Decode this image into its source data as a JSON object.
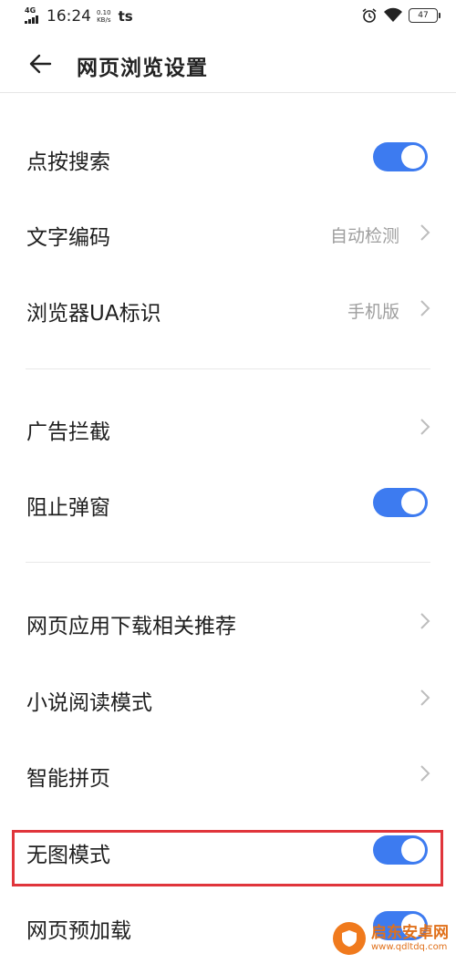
{
  "status": {
    "network": "4G",
    "time": "16:24",
    "speed_value": "0.10",
    "speed_unit": "KB/s",
    "app_glyph": "ts",
    "battery": "47"
  },
  "header": {
    "back_icon": "arrow-left-icon",
    "title": "网页浏览设置"
  },
  "settings": {
    "tap_search": {
      "label": "点按搜索",
      "toggle_on": true
    },
    "text_encoding": {
      "label": "文字编码",
      "value": "自动检测"
    },
    "ua": {
      "label": "浏览器UA标识",
      "value": "手机版"
    },
    "ad_block": {
      "label": "广告拦截"
    },
    "block_popup": {
      "label": "阻止弹窗",
      "toggle_on": true
    },
    "app_download": {
      "label": "网页应用下载相关推荐"
    },
    "novel_mode": {
      "label": "小说阅读模式"
    },
    "smart_page": {
      "label": "智能拼页"
    },
    "no_image": {
      "label": "无图模式",
      "toggle_on": true
    },
    "preload": {
      "label": "网页预加载",
      "toggle_on": true
    }
  },
  "colors": {
    "accent": "#3d7bf0",
    "highlight_border": "#e0353b",
    "secondary_text": "#9e9e9e"
  },
  "watermark": {
    "name": "启东安卓网",
    "url": "www.qdltdq.com"
  }
}
